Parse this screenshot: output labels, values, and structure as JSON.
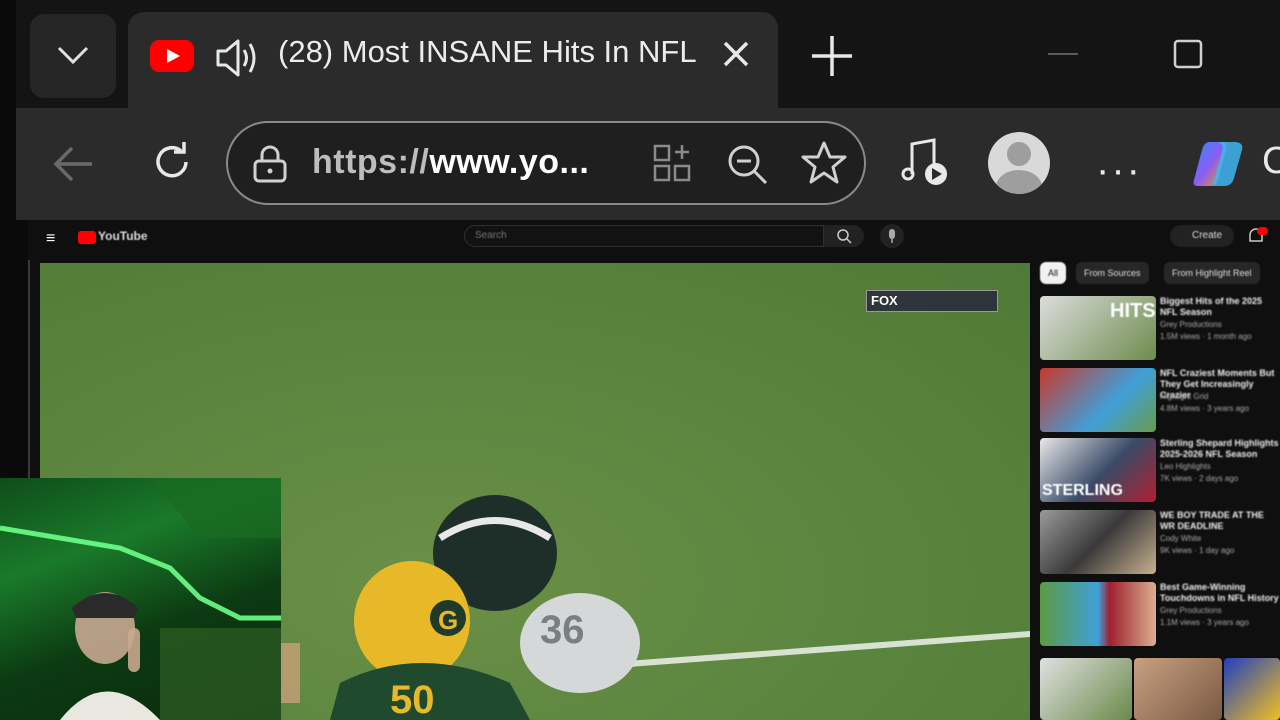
{
  "browser": {
    "tab": {
      "count_prefix": "(28)",
      "title": "(28) Most INSANE Hits In NFL"
    },
    "address": {
      "protocol": "https://",
      "host": "www.yo...",
      "full": "https://www.yo..."
    },
    "toolbar": {
      "more_label": "···",
      "copilot_letter": "C"
    }
  },
  "youtube": {
    "menu_glyph": "≡",
    "logo_text": "YouTube",
    "search_placeholder": "Search",
    "create_label": "Create",
    "chips": [
      "All",
      "From Sources",
      "From Highlight Reel"
    ],
    "overlay_logo": "FOX",
    "recommendations": [
      {
        "title": "Biggest Hits of the 2025 NFL Season",
        "channel": "Grey Productions",
        "meta": "1.5M views · 1 month ago",
        "thumb_text": "HITS",
        "color": "#d9d9d9"
      },
      {
        "title": "NFL Craziest Moments But They Get Increasingly Crazier",
        "channel": "Highlight Grid",
        "meta": "4.8M views · 3 years ago",
        "thumb_text": "",
        "color": "#c8382c"
      },
      {
        "title": "Sterling Shepard Highlights 2025-2026 NFL Season",
        "channel": "Leo Highlights",
        "meta": "7K views · 2 days ago",
        "thumb_text": "STERLING",
        "color": "#3a4a66"
      },
      {
        "title": "WE BOY TRADE AT THE WR DEADLINE",
        "channel": "Cody White",
        "meta": "9K views · 1 day ago",
        "thumb_text": "",
        "color": "#5a5a5a"
      },
      {
        "title": "Best Game-Winning Touchdowns in NFL History",
        "channel": "Grey Productions",
        "meta": "1.1M views · 3 years ago",
        "thumb_text": "",
        "color": "#a02030"
      }
    ]
  },
  "colors": {
    "tabstrip": "#141414",
    "tab_active": "#2b2b2b",
    "youtube_red": "#ff0000",
    "field_green": "#5d8640"
  }
}
